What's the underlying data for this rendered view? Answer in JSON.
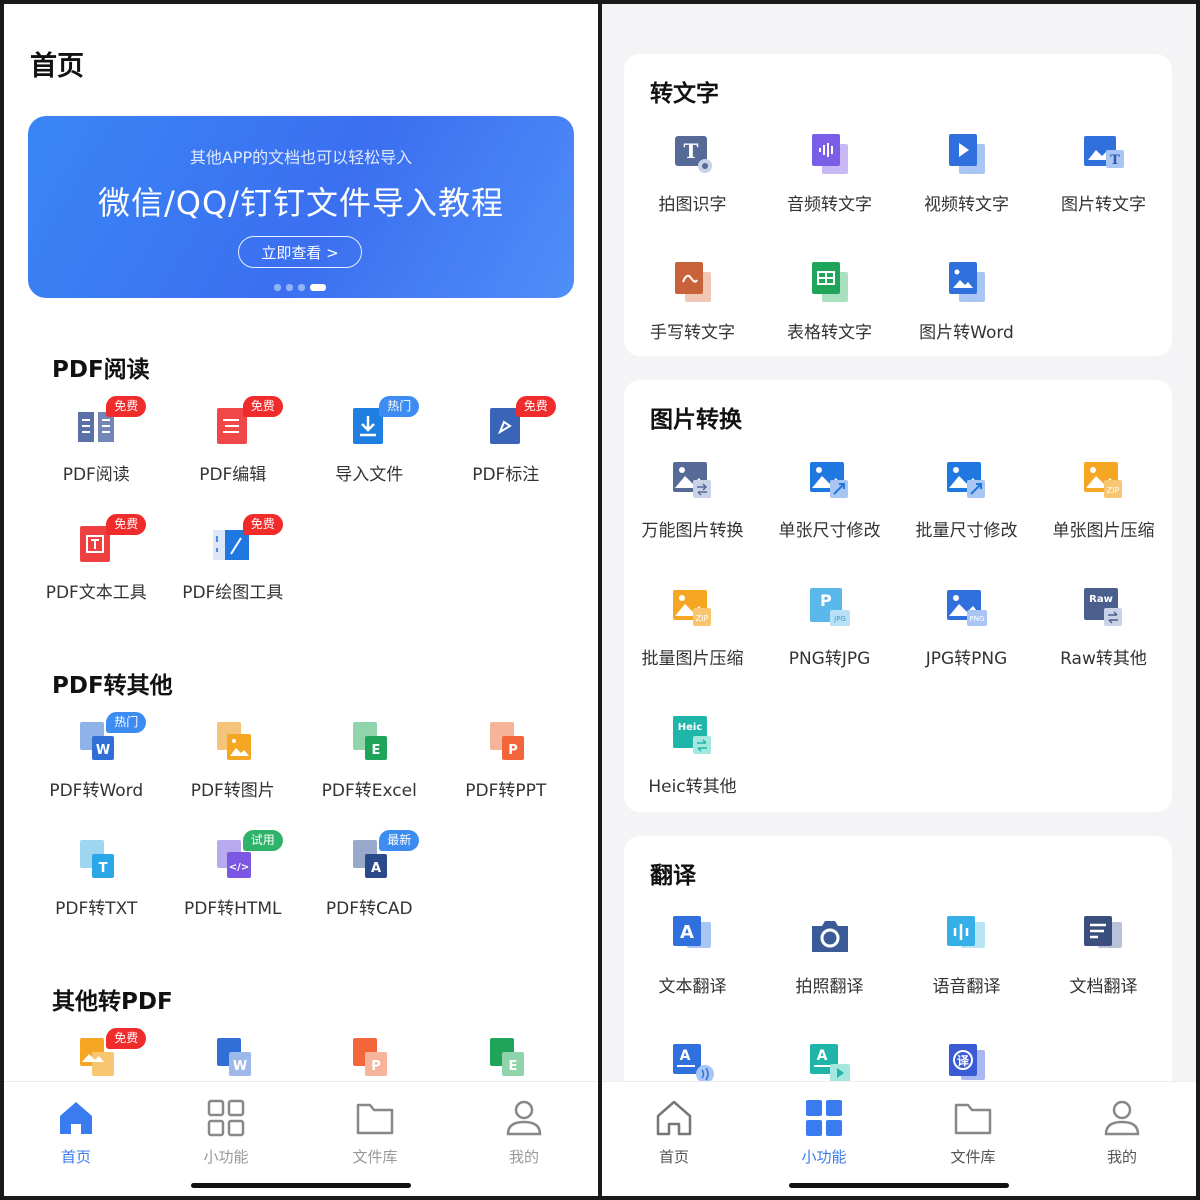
{
  "left": {
    "page_title": "首页",
    "banner": {
      "subtitle": "其他APP的文档也可以轻松导入",
      "headline": "微信/QQ/钉钉文件导入教程",
      "button": "立即查看 >"
    },
    "sections": [
      {
        "title": "PDF阅读",
        "items": [
          {
            "label": "PDF阅读",
            "badge": "免费",
            "badge_color": "red",
            "icon": "pdf-read-icon"
          },
          {
            "label": "PDF编辑",
            "badge": "免费",
            "badge_color": "red",
            "icon": "pdf-edit-icon"
          },
          {
            "label": "导入文件",
            "badge": "热门",
            "badge_color": "blue",
            "icon": "import-file-icon"
          },
          {
            "label": "PDF标注",
            "badge": "免费",
            "badge_color": "red",
            "icon": "pdf-annotate-icon"
          },
          {
            "label": "PDF文本工具",
            "badge": "免费",
            "badge_color": "red",
            "icon": "pdf-text-tool-icon"
          },
          {
            "label": "PDF绘图工具",
            "badge": "免费",
            "badge_color": "red",
            "icon": "pdf-draw-tool-icon"
          }
        ]
      },
      {
        "title": "PDF转其他",
        "items": [
          {
            "label": "PDF转Word",
            "badge": "热门",
            "badge_color": "blue",
            "icon": "pdf-to-word-icon"
          },
          {
            "label": "PDF转图片",
            "badge": "",
            "badge_color": "",
            "icon": "pdf-to-image-icon"
          },
          {
            "label": "PDF转Excel",
            "badge": "",
            "badge_color": "",
            "icon": "pdf-to-excel-icon"
          },
          {
            "label": "PDF转PPT",
            "badge": "",
            "badge_color": "",
            "icon": "pdf-to-ppt-icon"
          },
          {
            "label": "PDF转TXT",
            "badge": "",
            "badge_color": "",
            "icon": "pdf-to-txt-icon"
          },
          {
            "label": "PDF转HTML",
            "badge": "试用",
            "badge_color": "green",
            "icon": "pdf-to-html-icon"
          },
          {
            "label": "PDF转CAD",
            "badge": "最新",
            "badge_color": "blue",
            "icon": "pdf-to-cad-icon"
          }
        ]
      },
      {
        "title": "其他转PDF",
        "items": [
          {
            "label": "",
            "badge": "免费",
            "badge_color": "red",
            "icon": "image-to-pdf-icon"
          },
          {
            "label": "",
            "badge": "",
            "badge_color": "",
            "icon": "word-to-pdf-icon"
          },
          {
            "label": "",
            "badge": "",
            "badge_color": "",
            "icon": "ppt-to-pdf-icon"
          },
          {
            "label": "",
            "badge": "",
            "badge_color": "",
            "icon": "excel-to-pdf-icon"
          }
        ]
      }
    ],
    "tabs": [
      {
        "label": "首页",
        "icon": "home-icon",
        "active": true
      },
      {
        "label": "小功能",
        "icon": "grid-icon",
        "active": false
      },
      {
        "label": "文件库",
        "icon": "folder-icon",
        "active": false
      },
      {
        "label": "我的",
        "icon": "user-icon",
        "active": false
      }
    ]
  },
  "right": {
    "cards": [
      {
        "title": "转文字",
        "items": [
          {
            "label": "拍图识字",
            "icon": "photo-ocr-icon"
          },
          {
            "label": "音频转文字",
            "icon": "audio-to-text-icon"
          },
          {
            "label": "视频转文字",
            "icon": "video-to-text-icon"
          },
          {
            "label": "图片转文字",
            "icon": "image-to-text-icon"
          },
          {
            "label": "手写转文字",
            "icon": "handwriting-to-text-icon"
          },
          {
            "label": "表格转文字",
            "icon": "table-to-text-icon"
          },
          {
            "label": "图片转Word",
            "icon": "image-to-word-icon"
          }
        ]
      },
      {
        "title": "图片转换",
        "items": [
          {
            "label": "万能图片转换",
            "icon": "image-convert-icon"
          },
          {
            "label": "单张尺寸修改",
            "icon": "single-resize-icon"
          },
          {
            "label": "批量尺寸修改",
            "icon": "batch-resize-icon"
          },
          {
            "label": "单张图片压缩",
            "icon": "single-compress-icon"
          },
          {
            "label": "批量图片压缩",
            "icon": "batch-compress-icon"
          },
          {
            "label": "PNG转JPG",
            "icon": "png-to-jpg-icon"
          },
          {
            "label": "JPG转PNG",
            "icon": "jpg-to-png-icon"
          },
          {
            "label": "Raw转其他",
            "icon": "raw-convert-icon"
          },
          {
            "label": "Heic转其他",
            "icon": "heic-convert-icon"
          }
        ]
      },
      {
        "title": "翻译",
        "items": [
          {
            "label": "文本翻译",
            "icon": "text-translate-icon"
          },
          {
            "label": "拍照翻译",
            "icon": "camera-translate-icon"
          },
          {
            "label": "语音翻译",
            "icon": "voice-translate-icon"
          },
          {
            "label": "文档翻译",
            "icon": "document-translate-icon"
          },
          {
            "label": "",
            "icon": "audio-translate-icon"
          },
          {
            "label": "",
            "icon": "video-translate-icon"
          },
          {
            "label": "",
            "icon": "realtime-translate-icon"
          }
        ]
      }
    ],
    "tabs": [
      {
        "label": "首页",
        "icon": "home-icon",
        "active": false
      },
      {
        "label": "小功能",
        "icon": "grid-icon",
        "active": true
      },
      {
        "label": "文件库",
        "icon": "folder-icon",
        "active": false
      },
      {
        "label": "我的",
        "icon": "user-icon",
        "active": false
      }
    ]
  },
  "colors": {
    "accent": "#3a7cf0",
    "badge_red": "#ef2b2b",
    "badge_blue": "#3c8cf2",
    "badge_green": "#2fb36a"
  }
}
